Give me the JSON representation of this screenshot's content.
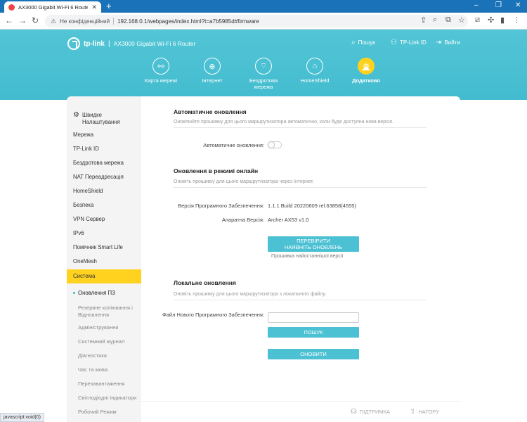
{
  "browser": {
    "tab_title": "AX3000 Gigabit Wi-Fi 6 Router",
    "insecure_label": "Не конфіденційний",
    "url": "192.168.0.1/webpages/index.html?t=a7b5985d#firmware"
  },
  "router": {
    "brand": "tp-link",
    "model": "AX3000 Gigabit Wi-Fi 6 Router",
    "top_links": {
      "search": "Пошук",
      "tplink_id": "TP-Link ID",
      "logout": "Вийти"
    },
    "nav": [
      {
        "label": "Карта мережі",
        "icon": "network-map-icon"
      },
      {
        "label": "Інтернет",
        "icon": "globe-icon"
      },
      {
        "label": "Бездротова мережа",
        "icon": "wifi-icon"
      },
      {
        "label": "HomeShield",
        "icon": "home-shield-icon"
      },
      {
        "label": "Додатково",
        "icon": "gear-icon"
      }
    ],
    "active_nav": "Додатково"
  },
  "sidebar": {
    "quick_setup": "Швидке Налаштування",
    "items": [
      "Мережа",
      "TP-Link ID",
      "Бездротова мережа",
      "NAT Переадресація",
      "HomeShield",
      "Безпека",
      "VPN Сервер",
      "IPv6",
      "Помічник Smart Life",
      "OneMesh",
      "Система"
    ],
    "active_item": "Система",
    "sub_active": "Оновлення ПЗ",
    "sub_items": [
      "Резервне копіювання і Відновлення",
      "Адміністрування",
      "Системний журнал",
      "Діагностика",
      "Час та мова",
      "Перезавантаження",
      "Світлодіодні Індикатори",
      "Робочий Режим"
    ]
  },
  "content": {
    "auto_update": {
      "title": "Автоматичне оновлення",
      "desc": "Оновлюйте прошивку для цього маршрутизатора автоматично, коли буде доступна нова версія.",
      "toggle_label": "Автоматичне оновлення:",
      "enabled": false
    },
    "online_update": {
      "title": "Оновлення в режимі онлайн",
      "desc": "Оновіть прошивку для цього маршрутизатора через Інтернет.",
      "fw_label": "Версія Програмного Забезпечення:",
      "fw_value": "1.1.1 Build 20220609 rel.63858(4555)",
      "hw_label": "Апаратна Версія:",
      "hw_value": "Archer AX53 v1.0",
      "check_button": "ПЕРЕВІРИТИ НАЯВНІТЬ ОНОВЛЕНЬ",
      "status_note": "Прошивка найостаннішої версії"
    },
    "local_update": {
      "title": "Локальне оновлення",
      "desc": "Оновіть прошивку для цього маршрутизатора з локального файлу.",
      "file_label": "Файл Нового Програмного Забезпечення:",
      "file_value": "",
      "browse_button": "ПОШУК",
      "update_button": "ОНОВИТИ"
    }
  },
  "footer": {
    "support": "ПІДТРИМКА",
    "top": "НАГОРУ"
  },
  "statusbar": "javascript:void(0)",
  "colors": {
    "header": "#4ec2d3",
    "accent": "#ffd21f",
    "button": "#4cc1d3"
  }
}
